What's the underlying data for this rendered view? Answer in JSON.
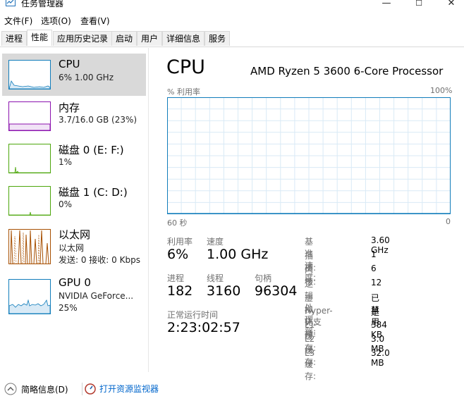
{
  "window": {
    "title": "任务管理器",
    "min": "—",
    "max": "☐",
    "close": "✕"
  },
  "menu": [
    "文件(F)",
    "选项(O)",
    "查看(V)"
  ],
  "tabs": [
    "进程",
    "性能",
    "应用历史记录",
    "启动",
    "用户",
    "详细信息",
    "服务"
  ],
  "active_tab": "性能",
  "sidebar": [
    {
      "title": "CPU",
      "sub1": "6% 1.00 GHz",
      "sub2": ""
    },
    {
      "title": "内存",
      "sub1": "3.7/16.0 GB (23%)",
      "sub2": ""
    },
    {
      "title": "磁盘 0 (E: F:)",
      "sub1": "1%",
      "sub2": ""
    },
    {
      "title": "磁盘 1 (C: D:)",
      "sub1": "0%",
      "sub2": ""
    },
    {
      "title": "以太网",
      "sub1": "以太网",
      "sub2": "发送: 0 接收: 0 Kbps"
    },
    {
      "title": "GPU 0",
      "sub1": "NVIDIA GeForce...",
      "sub2": "25%"
    }
  ],
  "colors": {
    "cpu": "#117dbb",
    "memory": "#8b12ae",
    "disk": "#4da60c",
    "ethernet": "#a74f01",
    "gpu": "#117dbb"
  },
  "main": {
    "heading": "CPU",
    "processor": "AMD Ryzen 5 3600 6-Core Processor",
    "graph_label": "% 利用率",
    "graph_max": "100%",
    "graph_time": "60 秒",
    "graph_zero": "0",
    "stats": {
      "util_label": "利用率",
      "util_value": "6%",
      "speed_label": "速度",
      "speed_value": "1.00 GHz",
      "proc_label": "进程",
      "proc_value": "182",
      "thread_label": "线程",
      "thread_value": "3160",
      "handle_label": "句柄",
      "handle_value": "96304",
      "uptime_label": "正常运行时间",
      "uptime_value": "2:23:02:57"
    },
    "specs": [
      {
        "k": "基准速度:",
        "v": "3.60 GHz"
      },
      {
        "k": "插槽:",
        "v": "1"
      },
      {
        "k": "内核:",
        "v": "6"
      },
      {
        "k": "逻辑处理器:",
        "v": "12"
      },
      {
        "k": "虚拟化:",
        "v": "已禁用"
      },
      {
        "k": "Hyper-V 支持:",
        "v": "是"
      },
      {
        "k": "L1 缓存:",
        "v": "384 KB"
      },
      {
        "k": "L2 缓存:",
        "v": "3.0 MB"
      },
      {
        "k": "L3 缓存:",
        "v": "32.0 MB"
      }
    ]
  },
  "cpu_history_percent": [
    0,
    0,
    0,
    0,
    0,
    0,
    0,
    0,
    0,
    0,
    0,
    0,
    0,
    0,
    0,
    0,
    0,
    0,
    0,
    0,
    0,
    0,
    0,
    0,
    0,
    0,
    0,
    0,
    0,
    0,
    0,
    0,
    0,
    0,
    0,
    0,
    0,
    0,
    0,
    0,
    0,
    0,
    0,
    0,
    0,
    0,
    0,
    0,
    0,
    0,
    0,
    0,
    0,
    0,
    0,
    0,
    0,
    0,
    0,
    0,
    0,
    0,
    0,
    0,
    0,
    0,
    0,
    0,
    0,
    0,
    0,
    0,
    0,
    0,
    0,
    0,
    0,
    0,
    0,
    0,
    0,
    0,
    0,
    0,
    0,
    0,
    0,
    0,
    0,
    0,
    0,
    0,
    0,
    0,
    0,
    0,
    0,
    0,
    0,
    0,
    0,
    0,
    0,
    0,
    0,
    0,
    0,
    0,
    0,
    0,
    0,
    0,
    0,
    0,
    0,
    0,
    0,
    0,
    0,
    0,
    0,
    0,
    0,
    0,
    0,
    0,
    0,
    0,
    0,
    0,
    0,
    0,
    0,
    0,
    0,
    0,
    0,
    0,
    0,
    0,
    0,
    0,
    0,
    0,
    0,
    0,
    0,
    0,
    0,
    0,
    0,
    0,
    0,
    0,
    0,
    0,
    0,
    0,
    0,
    0,
    0,
    0,
    0,
    0,
    0,
    0,
    0,
    0,
    0,
    0,
    0,
    0,
    0,
    0,
    0,
    0,
    0,
    0,
    0,
    0,
    0,
    0,
    0,
    0,
    0,
    0,
    0,
    0,
    0,
    0,
    0,
    0,
    0,
    0,
    0,
    0,
    0,
    0,
    0,
    0,
    0,
    0,
    0,
    0,
    0,
    0,
    0,
    0,
    0,
    0,
    0,
    0,
    0,
    0,
    0,
    0,
    0,
    0,
    0,
    0,
    0,
    0,
    0,
    0,
    0,
    0,
    0,
    0,
    0,
    0,
    0,
    0,
    0,
    0,
    0,
    0,
    0,
    0,
    0,
    0,
    0,
    0,
    0,
    0,
    0,
    0,
    0,
    0,
    0,
    0,
    0,
    0,
    0,
    0,
    0,
    0,
    0,
    0,
    0,
    0,
    0,
    0,
    0,
    0,
    0,
    0,
    0,
    0,
    0,
    0,
    0,
    0,
    0,
    0,
    0,
    0,
    0,
    0,
    0,
    0,
    0,
    0,
    0,
    0,
    0,
    0,
    0,
    0,
    0,
    0,
    0,
    0,
    0,
    0,
    0,
    0,
    0,
    0,
    0,
    0,
    0,
    0,
    0,
    0,
    0,
    0,
    0,
    0,
    0,
    0,
    0,
    0,
    0,
    0,
    0,
    0,
    0,
    0,
    0,
    0,
    0,
    0,
    0,
    0,
    0,
    0,
    0,
    0,
    0,
    0,
    0,
    0,
    0,
    0,
    0,
    0,
    0,
    0,
    0,
    0,
    0,
    0,
    0,
    0,
    0,
    0,
    0,
    0,
    0,
    0,
    0,
    0,
    0,
    0,
    0,
    0,
    0,
    0,
    0,
    0,
    0,
    0,
    0,
    0,
    0,
    0,
    0,
    0,
    0,
    0,
    0,
    0,
    0,
    0,
    0,
    0,
    0,
    0,
    0,
    0,
    0,
    0,
    0,
    0,
    0,
    0,
    0,
    0,
    0,
    0,
    0,
    0,
    0,
    0,
    0,
    0,
    0,
    0
  ],
  "footer": {
    "summary": "简略信息(D)",
    "monitor": "打开资源监视器"
  }
}
